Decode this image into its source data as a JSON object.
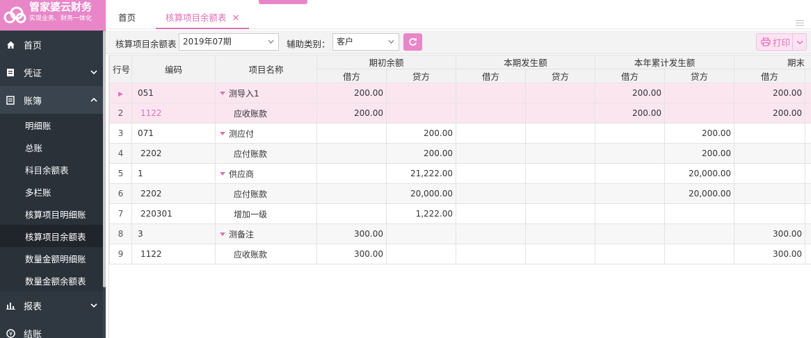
{
  "brand": {
    "title": "管家婆云财务",
    "subtitle": "实现业务、财务一体化",
    "color": "#e886c8"
  },
  "sidebar": {
    "items": [
      {
        "label": "首页",
        "icon": "home-icon"
      },
      {
        "label": "凭证",
        "icon": "voucher-icon"
      },
      {
        "label": "账簿",
        "icon": "ledger-icon"
      },
      {
        "label": "报表",
        "icon": "report-icon"
      },
      {
        "label": "结账",
        "icon": "close-account-icon"
      }
    ],
    "ledger_sub": [
      "明细账",
      "总账",
      "科目余额表",
      "多栏账",
      "核算项目明细账",
      "核算项目余额表",
      "数量金额明细账",
      "数量金额余额表"
    ]
  },
  "tabs": {
    "home": "首页",
    "current": "核算项目余额表",
    "close": "✕"
  },
  "toolbar": {
    "report_label": "核算项目余额表",
    "period_value": "2019年07期",
    "aux_label": "辅助类别：",
    "aux_value": "客户",
    "print_label": "打印"
  },
  "table": {
    "headers": {
      "rownum": "行号",
      "code": "编码",
      "name": "项目名称",
      "opening": "期初余额",
      "current": "本期发生额",
      "ytd": "本年累计发生额",
      "closing": "期末",
      "debit": "借方",
      "credit": "贷方"
    },
    "rows": [
      {
        "n": "1",
        "code": "051",
        "name": "测导入1",
        "group": true,
        "ob_d": "200.00",
        "ob_c": "",
        "cp_d": "",
        "cp_c": "",
        "ytd_d": "200.00",
        "ytd_c": "",
        "cl_d": "200.00"
      },
      {
        "n": "2",
        "code": "1122",
        "name": "应收账款",
        "group": false,
        "ob_d": "200.00",
        "ob_c": "",
        "cp_d": "",
        "cp_c": "",
        "ytd_d": "200.00",
        "ytd_c": "",
        "cl_d": "200.00"
      },
      {
        "n": "3",
        "code": "071",
        "name": "测应付",
        "group": true,
        "ob_d": "",
        "ob_c": "200.00",
        "cp_d": "",
        "cp_c": "",
        "ytd_d": "",
        "ytd_c": "200.00",
        "cl_d": ""
      },
      {
        "n": "4",
        "code": "2202",
        "name": "应付账款",
        "group": false,
        "ob_d": "",
        "ob_c": "200.00",
        "cp_d": "",
        "cp_c": "",
        "ytd_d": "",
        "ytd_c": "200.00",
        "cl_d": ""
      },
      {
        "n": "5",
        "code": "1",
        "name": "供应商",
        "group": true,
        "ob_d": "",
        "ob_c": "21,222.00",
        "cp_d": "",
        "cp_c": "",
        "ytd_d": "",
        "ytd_c": "20,000.00",
        "cl_d": ""
      },
      {
        "n": "6",
        "code": "2202",
        "name": "应付账款",
        "group": false,
        "ob_d": "",
        "ob_c": "20,000.00",
        "cp_d": "",
        "cp_c": "",
        "ytd_d": "",
        "ytd_c": "20,000.00",
        "cl_d": ""
      },
      {
        "n": "7",
        "code": "220301",
        "name": "增加一级",
        "group": false,
        "ob_d": "",
        "ob_c": "1,222.00",
        "cp_d": "",
        "cp_c": "",
        "ytd_d": "",
        "ytd_c": "",
        "cl_d": ""
      },
      {
        "n": "8",
        "code": "3",
        "name": "测备注",
        "group": true,
        "ob_d": "300.00",
        "ob_c": "",
        "cp_d": "",
        "cp_c": "",
        "ytd_d": "",
        "ytd_c": "",
        "cl_d": "300.00"
      },
      {
        "n": "9",
        "code": "1122",
        "name": "应收账款",
        "group": false,
        "ob_d": "300.00",
        "ob_c": "",
        "cp_d": "",
        "cp_c": "",
        "ytd_d": "",
        "ytd_c": "",
        "cl_d": "300.00"
      }
    ]
  }
}
